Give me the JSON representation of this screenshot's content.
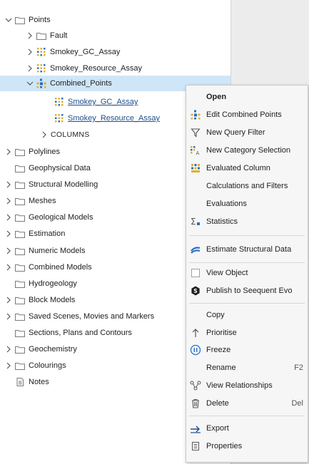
{
  "tree": {
    "points": "Points",
    "fault": "Fault",
    "smokey_gc_assay": "Smokey_GC_Assay",
    "smokey_resource_assay": "Smokey_Resource_Assay",
    "combined_points": "Combined_Points",
    "child_gc": "Smokey_GC_Assay",
    "child_resource": "Smokey_Resource_Assay",
    "columns": "COLUMNS",
    "polylines": "Polylines",
    "geophysical": "Geophysical Data",
    "structural": "Structural Modelling",
    "meshes": "Meshes",
    "geological": "Geological Models",
    "estimation": "Estimation",
    "numeric": "Numeric Models",
    "combined_models": "Combined Models",
    "hydrogeology": "Hydrogeology",
    "block_models": "Block Models",
    "saved_scenes": "Saved Scenes, Movies and Markers",
    "sections": "Sections, Plans and Contours",
    "geochemistry": "Geochemistry",
    "colourings": "Colourings",
    "notes": "Notes"
  },
  "menu": {
    "open": "Open",
    "edit_combined": "Edit Combined Points",
    "new_query": "New Query Filter",
    "new_category": "New Category Selection",
    "evaluated_column": "Evaluated Column",
    "calculations": "Calculations and Filters",
    "evaluations": "Evaluations",
    "statistics": "Statistics",
    "estimate_structural": "Estimate Structural Data",
    "view_object": "View Object",
    "publish": "Publish to Seequent Evo",
    "copy": "Copy",
    "prioritise": "Prioritise",
    "freeze": "Freeze",
    "rename": "Rename",
    "rename_shortcut": "F2",
    "view_relationships": "View Relationships",
    "delete": "Delete",
    "delete_shortcut": "Del",
    "export": "Export",
    "properties": "Properties"
  },
  "colors": {
    "selection": "#cfe6f8",
    "link": "#1f4e8c",
    "icon_yellow": "#e0b12a",
    "icon_blue": "#2a6fc4"
  }
}
